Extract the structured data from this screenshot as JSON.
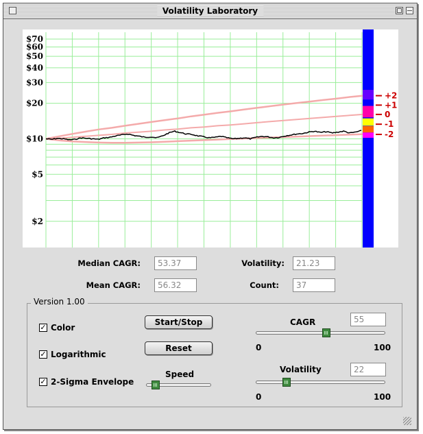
{
  "window": {
    "title": "Volatility Laboratory"
  },
  "chart_data": {
    "type": "line",
    "scale": "log",
    "y_tick_labels": [
      "$70",
      "$60",
      "$50",
      "$40",
      "$30",
      "$20",
      "$10",
      "$5",
      "$2"
    ],
    "y_tick_values": [
      70,
      60,
      50,
      40,
      30,
      20,
      10,
      5,
      2
    ],
    "ylim": [
      1.2,
      80
    ],
    "x_gridlines": 13,
    "grid": true,
    "series": [
      {
        "values": [
          10,
          9.9,
          10.1,
          10.0,
          9.8,
          9.9,
          10.2,
          10.1,
          10.0,
          9.9,
          10.2,
          10.3,
          10.6,
          10.8,
          11.0,
          10.7,
          10.5,
          10.3,
          10.4,
          10.2,
          10.6,
          11.2,
          11.6,
          11.3,
          11.0,
          10.9,
          10.6,
          10.4,
          10.2,
          10.3,
          10.5,
          10.2,
          10.0,
          10.1,
          10.2,
          10.0,
          10.3,
          10.5,
          10.4,
          10.2,
          10.3,
          10.6,
          10.8,
          11.0,
          11.1,
          11.4,
          11.6,
          11.3,
          11.5,
          11.2,
          11.4,
          11.6,
          11.2,
          11.4,
          11.7
        ]
      },
      {
        "values": [
          10,
          10.5,
          11.0,
          11.5,
          12.0,
          12.4,
          12.9,
          13.4,
          13.9,
          14.4,
          14.9,
          15.5,
          16.0,
          16.6,
          17.1,
          17.7,
          18.3,
          18.9,
          19.5,
          20.1,
          20.7,
          21.3,
          21.9,
          22.6,
          23.2
        ]
      },
      {
        "values": [
          10,
          9.7,
          9.5,
          9.4,
          9.3,
          9.25,
          9.25,
          9.3,
          9.35,
          9.45,
          9.55,
          9.65,
          9.75,
          9.85,
          9.95,
          10.05,
          10.15,
          10.25,
          10.35,
          10.45,
          10.55,
          10.65,
          10.75,
          10.85,
          10.95
        ]
      },
      {
        "values": [
          10,
          10.1,
          10.3,
          10.5,
          10.7,
          10.9,
          11.2,
          11.4,
          11.6,
          11.9,
          12.1,
          12.4,
          12.6,
          12.9,
          13.1,
          13.4,
          13.7,
          14.0,
          14.3,
          14.6,
          14.9,
          15.2,
          15.5,
          15.8,
          16.1
        ]
      }
    ],
    "color_bar": {
      "levels": [
        "+2",
        "+1",
        "0",
        "-1",
        "-2"
      ],
      "colors": {
        "background": "#0000ff",
        "plus2": "#6600ff",
        "plus1": "#ff00aa",
        "zero": "#ffff00",
        "minus1": "#ff6600",
        "minus2": "#ff00ff"
      }
    },
    "colors": {
      "grid": "#99ee99",
      "price": "#000000",
      "envelope": "#f4aaaa",
      "level_marks": "#cc0000"
    }
  },
  "stats": {
    "median_cagr_label": "Median CAGR:",
    "median_cagr_value": "53.37",
    "mean_cagr_label": "Mean CAGR:",
    "mean_cagr_value": "56.32",
    "volatility_label": "Volatility:",
    "volatility_value": "21.23",
    "count_label": "Count:",
    "count_value": "37"
  },
  "controls": {
    "version": "Version 1.00",
    "color_label": "Color",
    "color_checked": true,
    "log_label": "Logarithmic",
    "log_checked": true,
    "envelope_label": "2-Sigma Envelope",
    "envelope_checked": true,
    "start_stop_label": "Start/Stop",
    "reset_label": "Reset",
    "speed_label": "Speed",
    "speed_level": 0.1,
    "cagr_label": "CAGR",
    "cagr_value": "55",
    "cagr_min": "0",
    "cagr_max": "100",
    "volatility_label": "Volatility",
    "volatility_value": "22",
    "volatility_min": "0",
    "volatility_max": "100",
    "check_mark": "✓"
  }
}
